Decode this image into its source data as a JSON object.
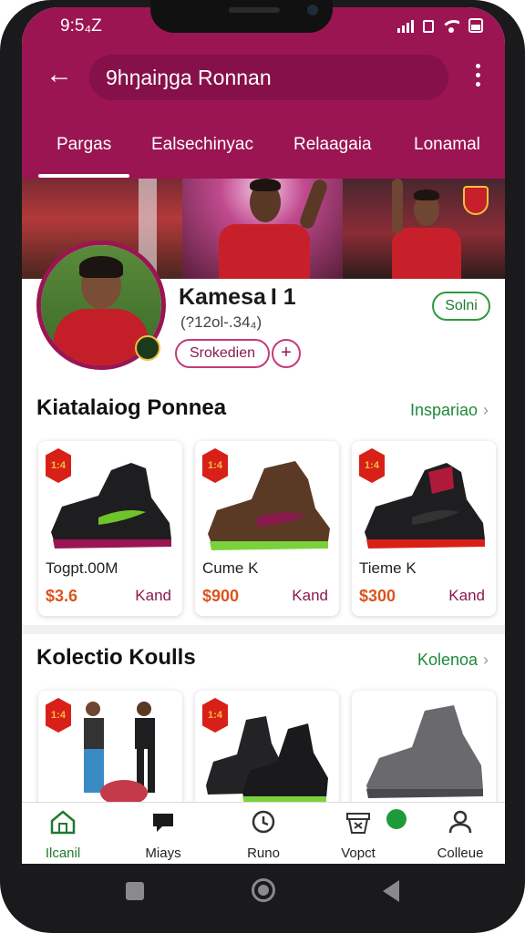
{
  "status_bar": {
    "time": "9:5₄Z"
  },
  "header": {
    "title": "9hŋaiŋga Ronnan",
    "tabs": [
      "Pargas",
      "Ealsechinyac",
      "Relaagaia",
      "Lonamal"
    ],
    "active_tab": 0
  },
  "profile": {
    "name": "Kamesa I 1",
    "subtitle": "(?12ol-.34₄)",
    "join_label": "Solni",
    "chip_label": "Srokedien",
    "chip_add": "+"
  },
  "section1": {
    "title": "Kiatalaiog Ponnea",
    "link": "Inspariao",
    "cards": [
      {
        "tag": "1:4",
        "title": "Togpt.00M",
        "price": "$3.6",
        "action": "Kand"
      },
      {
        "tag": "1:4",
        "title": "Cume K",
        "price": "$900",
        "action": "Kand"
      },
      {
        "tag": "1:4",
        "title": "Tieme K",
        "price": "$300",
        "action": "Kand"
      }
    ]
  },
  "section2": {
    "title": "Kolectio Koulls",
    "link": "Kolenoa",
    "cards": [
      {
        "tag": "1:4"
      },
      {
        "tag": "1:4"
      },
      {
        "tag": ""
      }
    ]
  },
  "bottom_nav": {
    "items": [
      "Ilcanil",
      "Miays",
      "Runo",
      "Vopct",
      "Colleue"
    ],
    "active": 0
  },
  "colors": {
    "brand": "#9b1553",
    "accent_green": "#1f8a3a",
    "price_orange": "#d9551e"
  },
  "icons": [
    "back-arrow-icon",
    "kebab-menu-icon",
    "home-icon",
    "flag-icon",
    "clock-icon",
    "basket-icon",
    "profile-icon",
    "chevron-right-icon"
  ]
}
